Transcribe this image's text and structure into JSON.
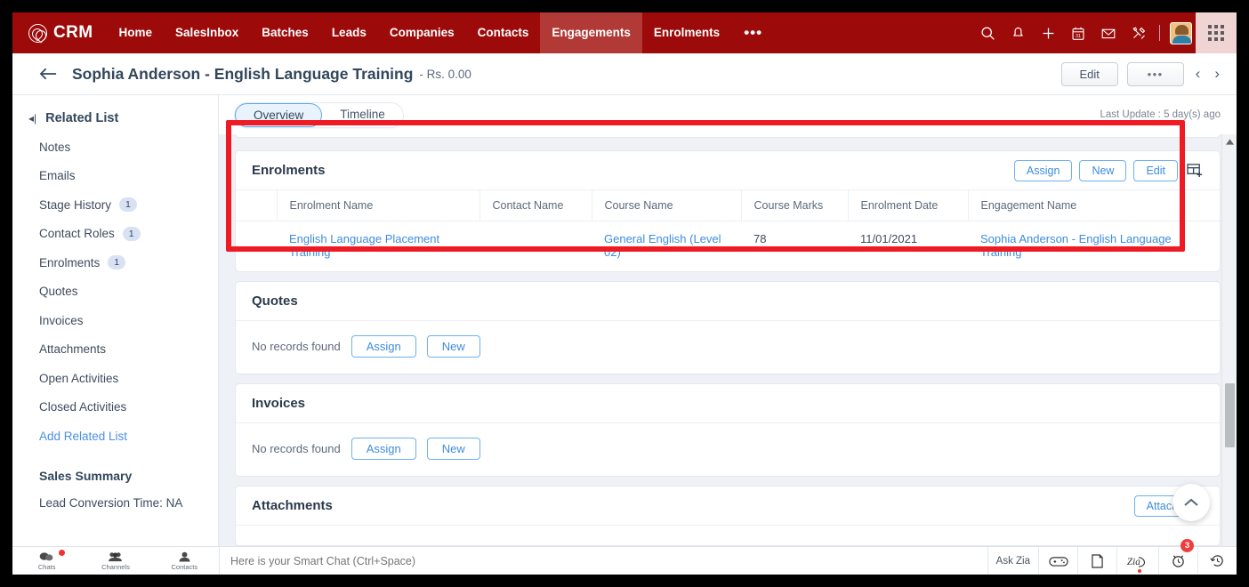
{
  "topnav": {
    "brand": "CRM",
    "logo_icon": "zoho-crm-logo-icon",
    "links": [
      {
        "label": "Home",
        "active": false
      },
      {
        "label": "SalesInbox",
        "active": false
      },
      {
        "label": "Batches",
        "active": false
      },
      {
        "label": "Leads",
        "active": false
      },
      {
        "label": "Companies",
        "active": false
      },
      {
        "label": "Contacts",
        "active": false
      },
      {
        "label": "Engagements",
        "active": true
      },
      {
        "label": "Enrolments",
        "active": false
      },
      {
        "label": "•••",
        "active": false
      }
    ],
    "icons": [
      "search-icon",
      "bell-icon",
      "plus-icon",
      "calendar-icon",
      "envelope-icon",
      "tools-icon"
    ],
    "calendar_day": "31",
    "accent_color": "#9c0a0a",
    "active_tab_color": "#b13a37"
  },
  "record_header": {
    "back_icon": "back-arrow-icon",
    "title": "Sophia Anderson - English Language Training",
    "amount": "- Rs. 0.00",
    "edit_label": "Edit",
    "more_label": "•••",
    "prev_icon": "chevron-left-icon",
    "next_icon": "chevron-right-icon"
  },
  "sidebar": {
    "title": "Related List",
    "collapse_icon": "panel-collapse-icon",
    "items": [
      {
        "label": "Notes",
        "badge": ""
      },
      {
        "label": "Emails",
        "badge": ""
      },
      {
        "label": "Stage History",
        "badge": "1"
      },
      {
        "label": "Contact Roles",
        "badge": "1"
      },
      {
        "label": "Enrolments",
        "badge": "1"
      },
      {
        "label": "Quotes",
        "badge": ""
      },
      {
        "label": "Invoices",
        "badge": ""
      },
      {
        "label": "Attachments",
        "badge": ""
      },
      {
        "label": "Open Activities",
        "badge": ""
      },
      {
        "label": "Closed Activities",
        "badge": ""
      }
    ],
    "add_related_list": "Add Related List",
    "summary_title": "Sales Summary",
    "summary_row": "Lead Conversion Time: NA"
  },
  "tabs": {
    "items": [
      {
        "label": "Overview",
        "active": true
      },
      {
        "label": "Timeline",
        "active": false
      }
    ],
    "last_update": "Last Update : 5 day(s) ago"
  },
  "enrolments": {
    "title": "Enrolments",
    "assign_label": "Assign",
    "new_label": "New",
    "edit_label": "Edit",
    "layout_icon": "add-column-icon",
    "columns": [
      "Enrolment Name",
      "Contact Name",
      "Course Name",
      "Course Marks",
      "Enrolment Date",
      "Engagement Name"
    ],
    "rows": [
      {
        "enrolment_name": "English Language Placement Training",
        "contact_name": "",
        "course_name": "General English (Level 02)",
        "course_marks": "78",
        "enrolment_date": "11/01/2021",
        "engagement_name": "Sophia Anderson - English Language Training"
      }
    ],
    "highlight_color": "#ee1b24"
  },
  "quotes": {
    "title": "Quotes",
    "empty_text": "No records found",
    "assign_label": "Assign",
    "new_label": "New"
  },
  "invoices": {
    "title": "Invoices",
    "empty_text": "No records found",
    "assign_label": "Assign",
    "new_label": "New"
  },
  "attachments": {
    "title": "Attachments",
    "attach_label": "Attach",
    "dropdown_icon": "caret-down-icon"
  },
  "scroll": {
    "up_icon": "scroll-to-top-icon",
    "arrow_up_icon": "scrollbar-up-arrow-icon",
    "arrow_down_icon": "scrollbar-down-arrow-icon"
  },
  "bottombar": {
    "tools": [
      {
        "label": "Chats",
        "icon": "chat-bubbles-icon",
        "dot": true
      },
      {
        "label": "Channels",
        "icon": "channels-group-icon",
        "dot": false
      },
      {
        "label": "Contacts",
        "icon": "contact-person-icon",
        "dot": false
      }
    ],
    "chat_placeholder": "Here is your Smart Chat (Ctrl+Space)",
    "ask_zia_label": "Ask Zia",
    "right_icons": [
      {
        "name": "gamepad-icon",
        "badge": ""
      },
      {
        "name": "notes-icon",
        "badge": ""
      },
      {
        "name": "zia-icon",
        "badge": ""
      },
      {
        "name": "alarm-clock-icon",
        "badge": "3"
      },
      {
        "name": "history-clock-icon",
        "badge": ""
      }
    ]
  }
}
